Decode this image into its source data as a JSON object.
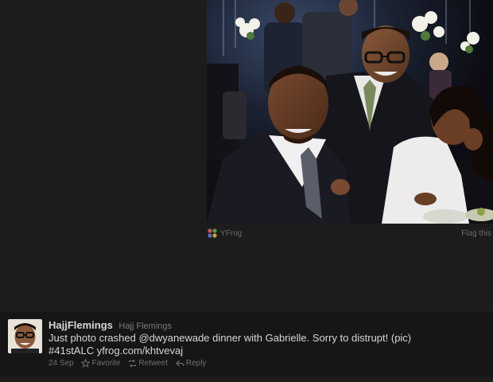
{
  "media": {
    "provider_label": "YFrog",
    "flag_label": "Flag this"
  },
  "tweet": {
    "display_name": "HajjFlemings",
    "screen_name": "Hajj Flemings",
    "text_line1": "Just photo crashed @dwyanewade dinner with Gabrielle. Sorry to distrupt! (pic)",
    "text_line2": "#41stALC yfrog.com/khtvevaj",
    "date": "24 Sep",
    "favorite_label": "Favorite",
    "retweet_label": "Retweet",
    "reply_label": "Reply"
  },
  "colors": {
    "background": "#1c1c1c",
    "tweet_bg": "#161616",
    "name": "#d8d8d8",
    "muted": "#6f6f6f"
  },
  "icons": [
    "yfrog-icon",
    "star-icon",
    "retweet-icon",
    "reply-icon"
  ]
}
